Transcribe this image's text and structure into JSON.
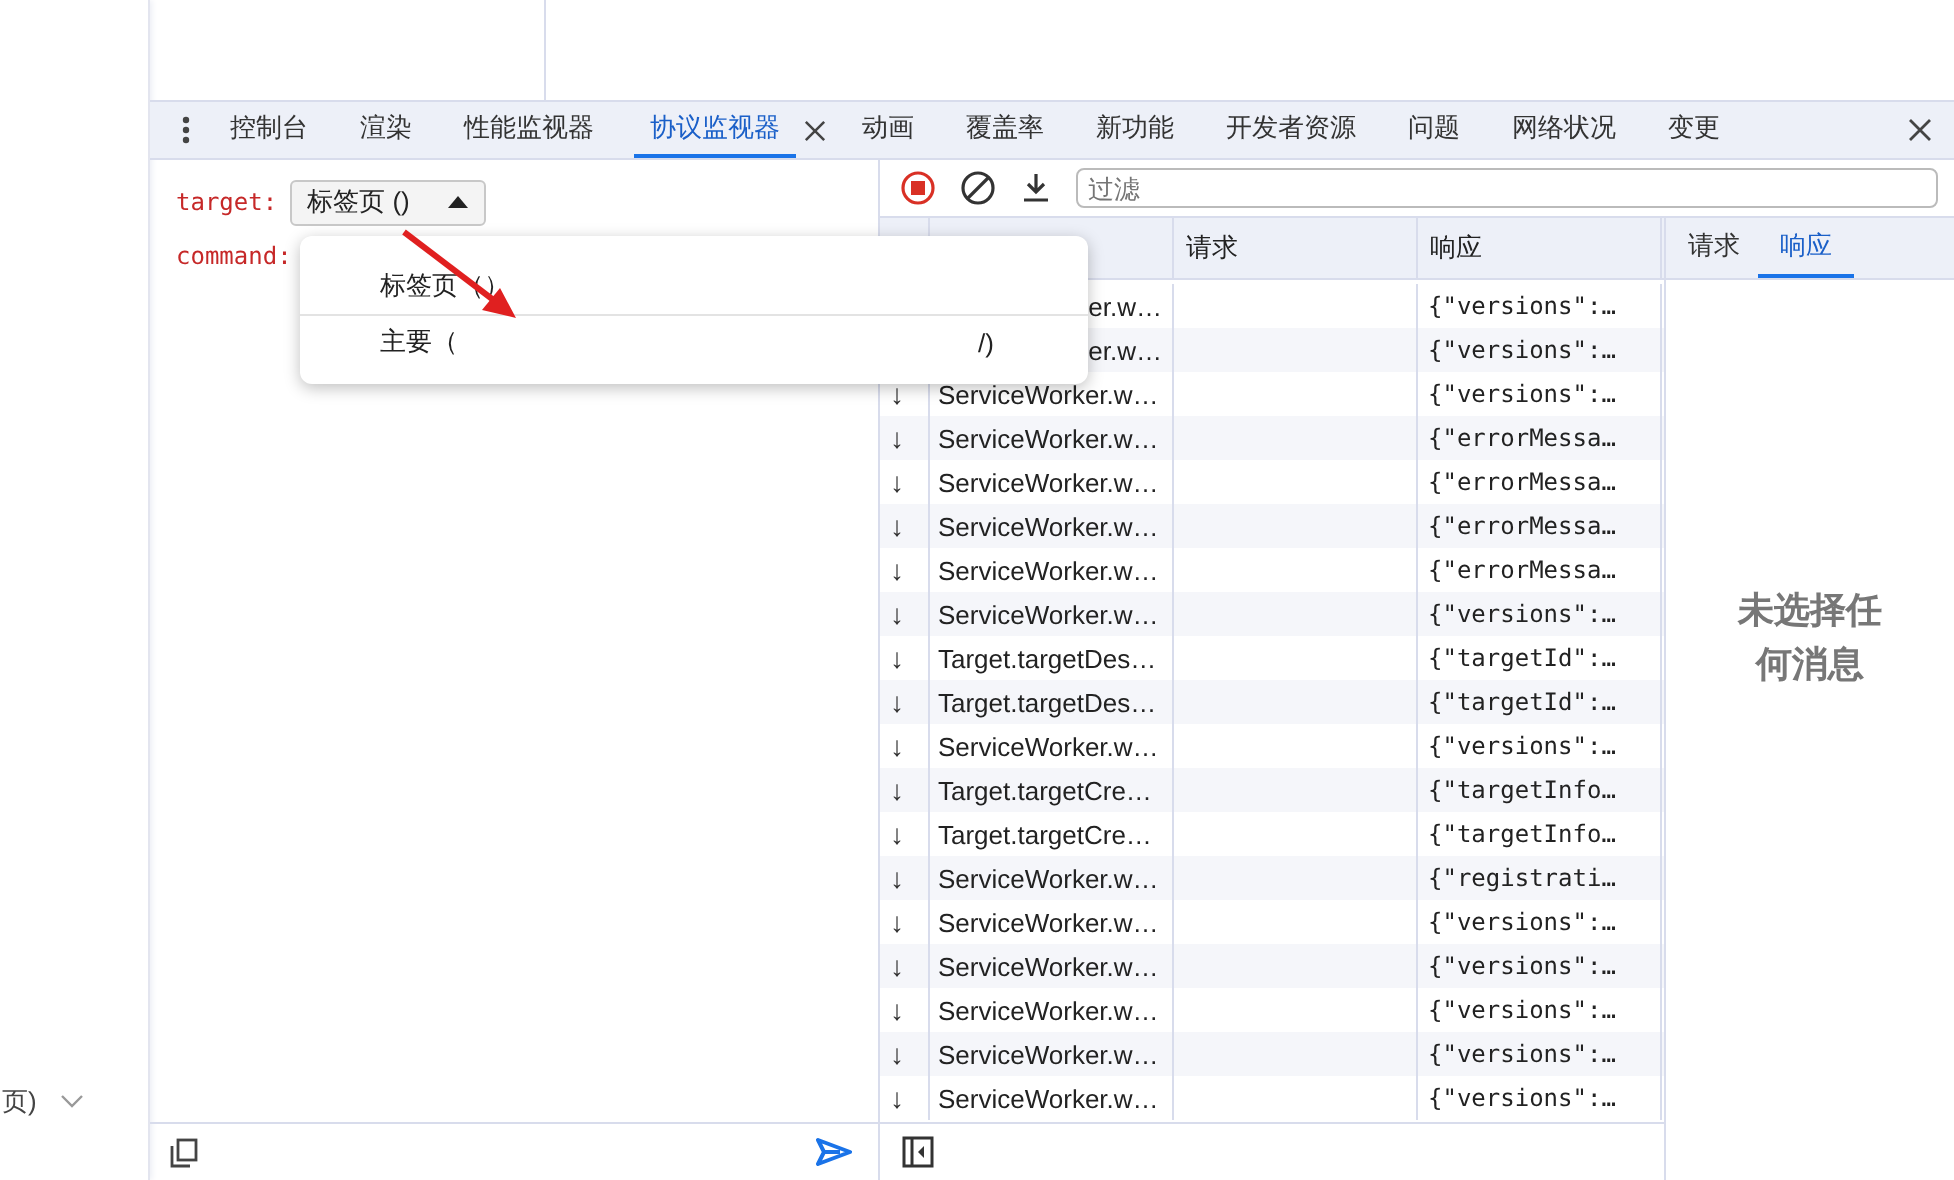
{
  "page": {
    "sidebar_text": "页)"
  },
  "tabs": [
    {
      "label": "控制台",
      "selected": false,
      "closable": false
    },
    {
      "label": "渲染",
      "selected": false,
      "closable": false
    },
    {
      "label": "性能监视器",
      "selected": false,
      "closable": false
    },
    {
      "label": "协议监视器",
      "selected": true,
      "closable": true
    },
    {
      "label": "动画",
      "selected": false,
      "closable": false
    },
    {
      "label": "覆盖率",
      "selected": false,
      "closable": false
    },
    {
      "label": "新功能",
      "selected": false,
      "closable": false
    },
    {
      "label": "开发者资源",
      "selected": false,
      "closable": false
    },
    {
      "label": "问题",
      "selected": false,
      "closable": false
    },
    {
      "label": "网络状况",
      "selected": false,
      "closable": false
    },
    {
      "label": "变更",
      "selected": false,
      "closable": false
    }
  ],
  "editor": {
    "target_label": "target:",
    "target_value": "标签页 ()",
    "command_label": "command:"
  },
  "target_menu": {
    "items": [
      {
        "label": "标签页（）"
      },
      {
        "label": "主要（",
        "tail": "/)"
      }
    ]
  },
  "toolbar": {
    "recording": true,
    "filter_placeholder": "过滤"
  },
  "table": {
    "columns": [
      "请求",
      "响应"
    ],
    "rows": [
      {
        "covered": true,
        "method": "er.w…",
        "response": "{\"versions\":…"
      },
      {
        "covered": true,
        "method": "er.w…",
        "response": "{\"versions\":…"
      },
      {
        "covered": false,
        "arrow": "↓",
        "method": "ServiceWorker.w…",
        "response": "{\"versions\":…"
      },
      {
        "covered": false,
        "arrow": "↓",
        "method": "ServiceWorker.w…",
        "response": "{\"errorMessa…"
      },
      {
        "covered": false,
        "arrow": "↓",
        "method": "ServiceWorker.w…",
        "response": "{\"errorMessa…"
      },
      {
        "covered": false,
        "arrow": "↓",
        "method": "ServiceWorker.w…",
        "response": "{\"errorMessa…"
      },
      {
        "covered": false,
        "arrow": "↓",
        "method": "ServiceWorker.w…",
        "response": "{\"errorMessa…"
      },
      {
        "covered": false,
        "arrow": "↓",
        "method": "ServiceWorker.w…",
        "response": "{\"versions\":…"
      },
      {
        "covered": false,
        "arrow": "↓",
        "method": "Target.targetDes…",
        "response": "{\"targetId\":…"
      },
      {
        "covered": false,
        "arrow": "↓",
        "method": "Target.targetDes…",
        "response": "{\"targetId\":…"
      },
      {
        "covered": false,
        "arrow": "↓",
        "method": "ServiceWorker.w…",
        "response": "{\"versions\":…"
      },
      {
        "covered": false,
        "arrow": "↓",
        "method": "Target.targetCre…",
        "response": "{\"targetInfo…"
      },
      {
        "covered": false,
        "arrow": "↓",
        "method": "Target.targetCre…",
        "response": "{\"targetInfo…"
      },
      {
        "covered": false,
        "arrow": "↓",
        "method": "ServiceWorker.w…",
        "response": "{\"registrati…"
      },
      {
        "covered": false,
        "arrow": "↓",
        "method": "ServiceWorker.w…",
        "response": "{\"versions\":…"
      },
      {
        "covered": false,
        "arrow": "↓",
        "method": "ServiceWorker.w…",
        "response": "{\"versions\":…"
      },
      {
        "covered": false,
        "arrow": "↓",
        "method": "ServiceWorker.w…",
        "response": "{\"versions\":…"
      },
      {
        "covered": false,
        "arrow": "↓",
        "method": "ServiceWorker.w…",
        "response": "{\"versions\":…"
      },
      {
        "covered": false,
        "arrow": "↓",
        "method": "ServiceWorker.w…",
        "response": "{\"versions\":…"
      }
    ]
  },
  "detail": {
    "tabs": [
      {
        "label": "请求",
        "selected": false
      },
      {
        "label": "响应",
        "selected": true
      }
    ],
    "empty_message": "未选择任何消息"
  }
}
